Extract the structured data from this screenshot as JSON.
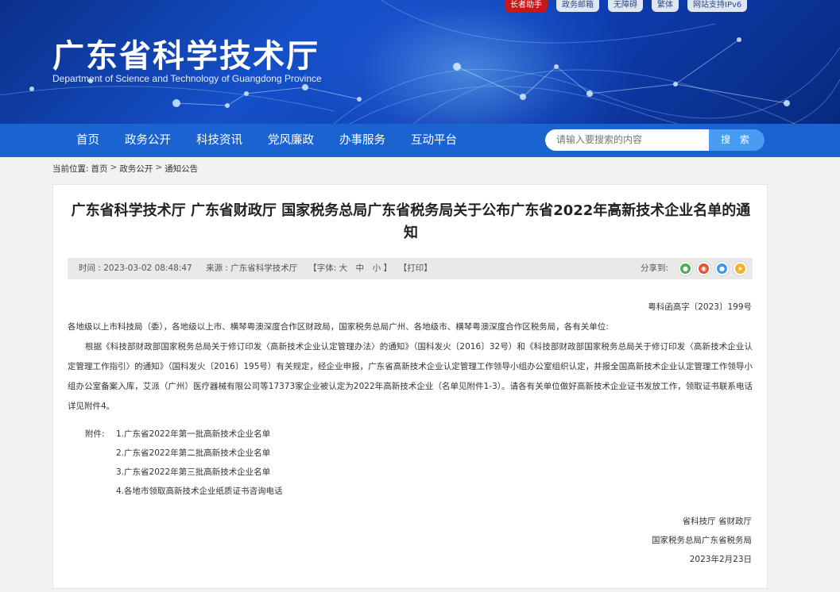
{
  "top_links": [
    "长者助手",
    "政务邮箱",
    "无障碍",
    "繁体",
    "网站支持IPv6"
  ],
  "header": {
    "title": "广东省科学技术厅",
    "subtitle": "Department of Science and Technology of Guangdong Province"
  },
  "nav": {
    "items": [
      "首页",
      "政务公开",
      "科技资讯",
      "党风廉政",
      "办事服务",
      "互动平台"
    ],
    "search_placeholder": "请输入要搜索的内容",
    "search_button": "搜 索"
  },
  "breadcrumb": {
    "label": "当前位置:",
    "items": [
      "首页",
      "政务公开",
      "通知公告"
    ],
    "separator": ">"
  },
  "article": {
    "title": "广东省科学技术厅 广东省财政厅 国家税务总局广东省税务局关于公布广东省2022年高新技术企业名单的通知",
    "meta": {
      "time": "时间 : 2023-03-02 08:48:47",
      "source": "来源 : 广东省科学技术厅",
      "font_size_label": "【字体: 大　中　小 】",
      "print_label": "【打印】",
      "share_label": "分享到:"
    },
    "doc_number": "粤科函高字〔2023〕199号",
    "addressee": "各地级以上市科技局（委），各地级以上市、横琴粤澳深度合作区财政局，国家税务总局广州、各地级市、横琴粤澳深度合作区税务局，各有关单位:",
    "paragraph": "根据《科技部财政部国家税务总局关于修订印发〈高新技术企业认定管理办法〉的通知》（国科发火〔2016〕32号）和《科技部财政部国家税务总局关于修订印发〈高新技术企业认定管理工作指引〉的通知》（国科发火〔2016〕195号）有关规定，经企业申报，广东省高新技术企业认定管理工作领导小组办公室组织认定，并报全国高新技术企业认定管理工作领导小组办公室备案入库，艾派（广州）医疗器械有限公司等17373家企业被认定为2022年高新技术企业（名单见附件1-3）。请各有关单位做好高新技术企业证书发放工作，领取证书联系电话详见附件4。",
    "attachments_label": "附件:",
    "attachments": [
      "1.广东省2022年第一批高新技术企业名单",
      "2.广东省2022年第二批高新技术企业名单",
      "3.广东省2022年第三批高新技术企业名单",
      "4.各地市领取高新技术企业纸质证书咨询电话"
    ],
    "signature": [
      "省科技厅 省财政厅",
      "国家税务总局广东省税务局",
      "2023年2月23日"
    ]
  },
  "colors": {
    "nav_bg": "#1b63d0",
    "search_button": "#4a9cf3",
    "badge_red": "#c81818",
    "share_wechat": "#4cb050",
    "share_weibo": "#e6542e",
    "share_qq": "#3a9ae8",
    "share_qzone": "#f2b32b"
  },
  "share_icons": [
    "wechat-icon",
    "weibo-icon",
    "qq-icon",
    "qzone-icon"
  ]
}
